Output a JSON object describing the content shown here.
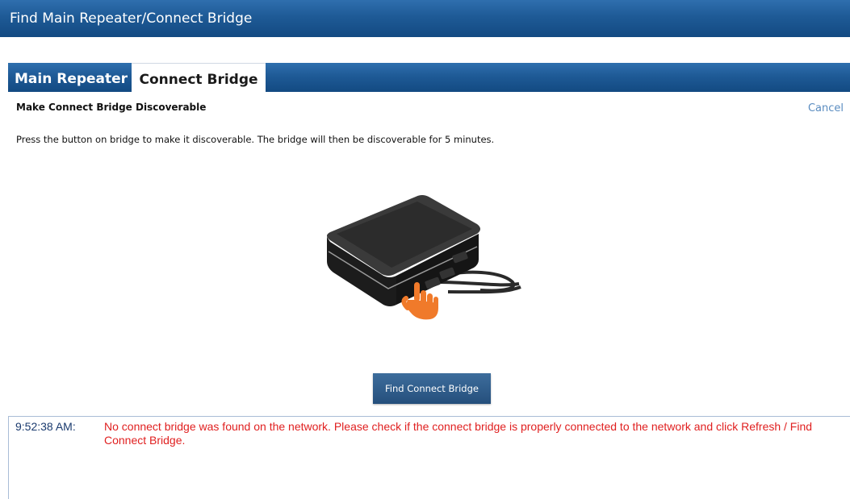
{
  "window": {
    "title": "Find Main Repeater/Connect Bridge"
  },
  "tabs": [
    {
      "label": "Main Repeater",
      "active": false
    },
    {
      "label": "Connect Bridge",
      "active": true
    }
  ],
  "content": {
    "heading": "Make Connect Bridge Discoverable",
    "cancel_label": "Cancel",
    "instruction": "Press the button on bridge to make it discoverable. The bridge will then be discoverable for 5 minutes.",
    "find_button_label": "Find Connect Bridge"
  },
  "log": {
    "entries": [
      {
        "time": "9:52:38 AM:",
        "message": "No connect bridge was found on the network. Please check if the connect bridge is properly connected to the network and click Refresh / Find Connect Bridge."
      }
    ]
  },
  "colors": {
    "title_bar": "#1e5a96",
    "link": "#5a8cc0",
    "error_text": "#e02020",
    "timestamp": "#1a3a6e",
    "hand": "#f07a2a"
  },
  "icons": {
    "illustration": "bridge-device-with-pointing-hand"
  }
}
